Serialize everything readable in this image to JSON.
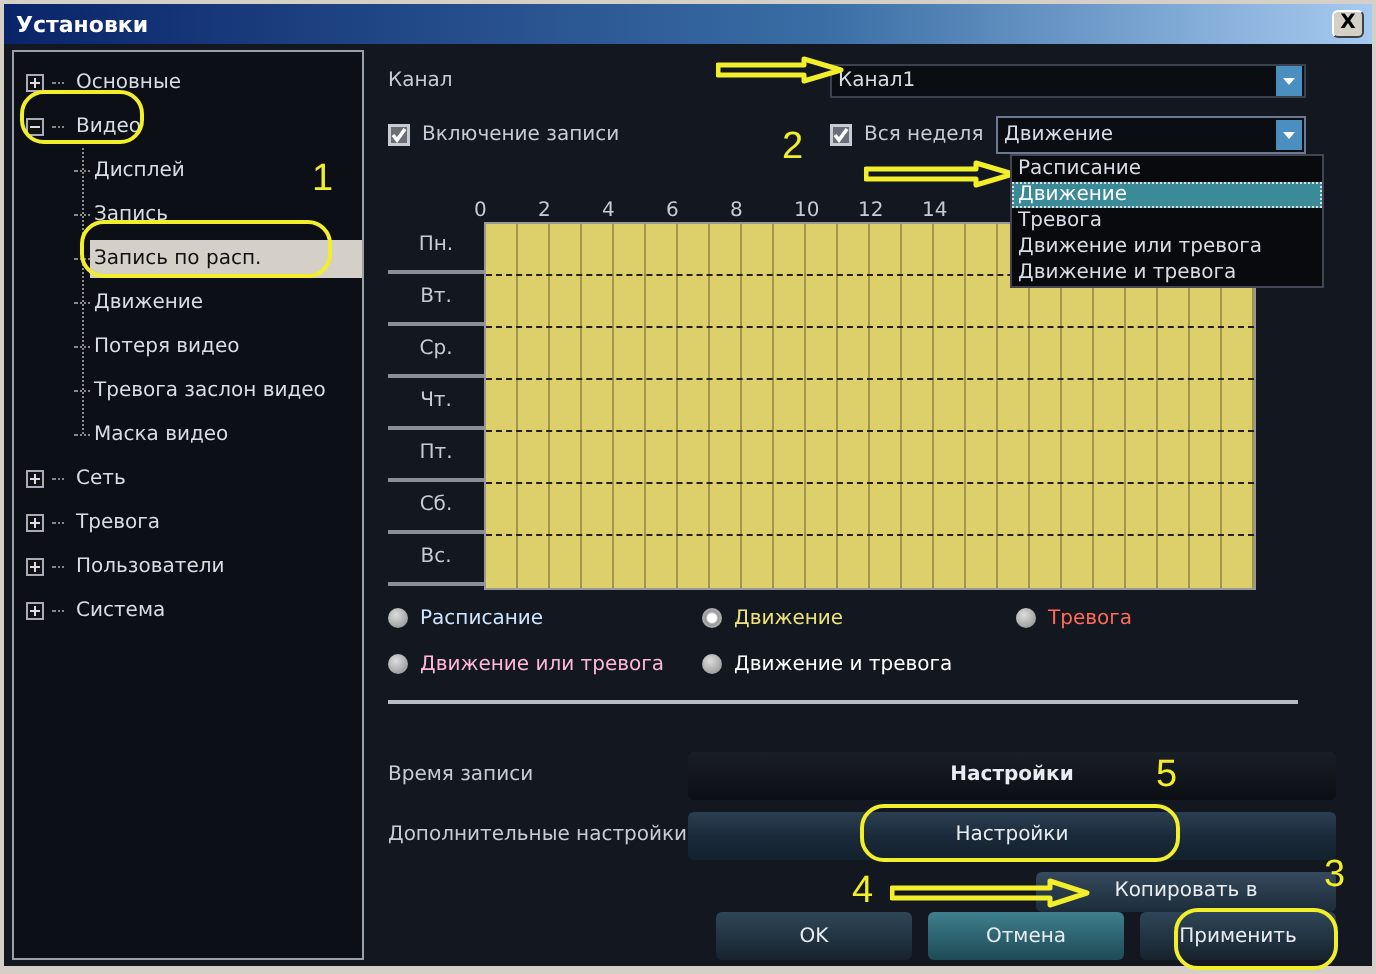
{
  "window": {
    "title": "Установки",
    "close": "X"
  },
  "nav_tree": [
    {
      "label": "Основные",
      "expanded": false,
      "selected": false
    },
    {
      "label": "Видео",
      "expanded": true,
      "selected": false,
      "children": [
        {
          "label": "Дисплей",
          "selected": false
        },
        {
          "label": "Запись",
          "selected": false
        },
        {
          "label": "Запись по расп.",
          "selected": true
        },
        {
          "label": "Движение",
          "selected": false
        },
        {
          "label": "Потеря видео",
          "selected": false
        },
        {
          "label": "Тревога заслон видео",
          "selected": false
        },
        {
          "label": "Маска видео",
          "selected": false
        }
      ]
    },
    {
      "label": "Сеть",
      "expanded": false,
      "selected": false
    },
    {
      "label": "Тревога",
      "expanded": false,
      "selected": false
    },
    {
      "label": "Пользователи",
      "expanded": false,
      "selected": false
    },
    {
      "label": "Система",
      "expanded": false,
      "selected": false
    }
  ],
  "channel": {
    "label": "Канал",
    "value": "Канал1"
  },
  "record_enable": {
    "label": "Включение записи",
    "checked": true
  },
  "whole_week": {
    "label": "Вся неделя",
    "checked": true
  },
  "mode_dropdown": {
    "value": "Движение",
    "expanded": true,
    "options": [
      {
        "label": "Расписание",
        "selected": false
      },
      {
        "label": "Движение",
        "selected": true
      },
      {
        "label": "Тревога",
        "selected": false
      },
      {
        "label": "Движение или тревога",
        "selected": false
      },
      {
        "label": "Движение и тревога",
        "selected": false
      }
    ]
  },
  "schedule": {
    "hour_labels": [
      "0",
      "2",
      "4",
      "6",
      "8",
      "10",
      "12",
      "14"
    ],
    "days": [
      {
        "label": "Пн.",
        "color": "#ddd06a"
      },
      {
        "label": "Вт.",
        "color": "#ddd06a"
      },
      {
        "label": "Ср.",
        "color": "#ddd06a"
      },
      {
        "label": "Чт.",
        "color": "#ddd06a"
      },
      {
        "label": "Пт.",
        "color": "#ddd06a"
      },
      {
        "label": "Сб.",
        "color": "#ddd06a"
      },
      {
        "label": "Вс.",
        "color": "#ddd06a"
      }
    ]
  },
  "legend": [
    {
      "label": "Расписание",
      "color": "#cfe4ff",
      "selected": false
    },
    {
      "label": "Движение",
      "color": "#ede27a",
      "selected": true
    },
    {
      "label": "Тревога",
      "color": "#ff6a5a",
      "selected": false
    },
    {
      "label": "Движение или тревога",
      "color": "#ffb8d8",
      "selected": false
    },
    {
      "label": "Движение и тревога",
      "color": "#ffffff",
      "selected": false
    }
  ],
  "record_time": {
    "label": "Время записи",
    "button": "Настройки"
  },
  "advanced": {
    "label": "Дополнительные настройки",
    "button": "Настройки"
  },
  "copy_button": "Копировать в",
  "footer_buttons": [
    {
      "label": "OK",
      "focused": false
    },
    {
      "label": "Отмена",
      "focused": true
    },
    {
      "label": "Применить",
      "focused": false
    }
  ],
  "annotations": [
    {
      "kind": "ellipse"
    },
    {
      "kind": "ellipse"
    },
    {
      "kind": "number",
      "text": "1"
    },
    {
      "kind": "arrow"
    },
    {
      "kind": "number",
      "text": "2"
    },
    {
      "kind": "arrow"
    },
    {
      "kind": "number",
      "text": "5"
    },
    {
      "kind": "ellipse"
    },
    {
      "kind": "number",
      "text": "4"
    },
    {
      "kind": "arrow"
    },
    {
      "kind": "number",
      "text": "3"
    },
    {
      "kind": "ellipse"
    }
  ]
}
